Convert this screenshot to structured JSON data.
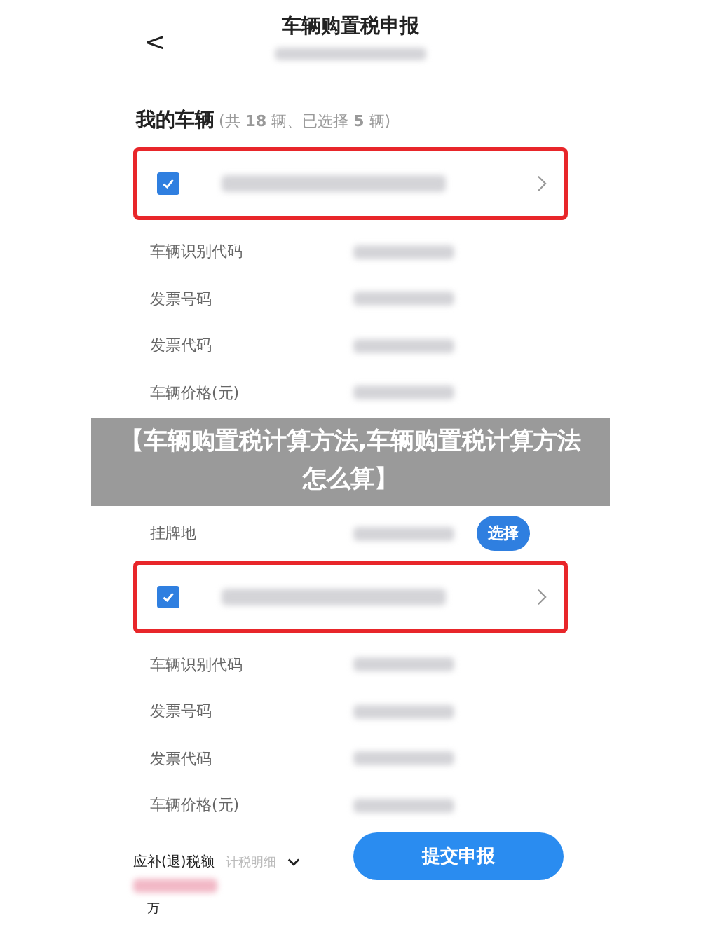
{
  "header": {
    "title": "车辆购置税申报",
    "back": "<"
  },
  "section": {
    "title": "我的车辆",
    "summary": "(共 **18** 辆、已选择 **5** 辆)"
  },
  "vehicles": [
    {
      "checked": true,
      "highlighted": true,
      "fields": [
        {
          "label": "车辆识别代码"
        },
        {
          "label": "发票号码"
        },
        {
          "label": "发票代码"
        },
        {
          "label": "车辆价格(元)"
        },
        {
          "label": "挂牌地",
          "action": "选择"
        }
      ]
    },
    {
      "checked": true,
      "highlighted": true,
      "fields": [
        {
          "label": "车辆识别代码"
        },
        {
          "label": "发票号码"
        },
        {
          "label": "发票代码"
        },
        {
          "label": "车辆价格(元)"
        }
      ]
    }
  ],
  "footer": {
    "tax_label": "应补(退)税额",
    "detail_link": "计税明细",
    "unit": "万",
    "submit": "提交申报"
  },
  "banner": {
    "text": "【车辆购置税计算方法,车辆购置税计算方法怎么算】"
  }
}
